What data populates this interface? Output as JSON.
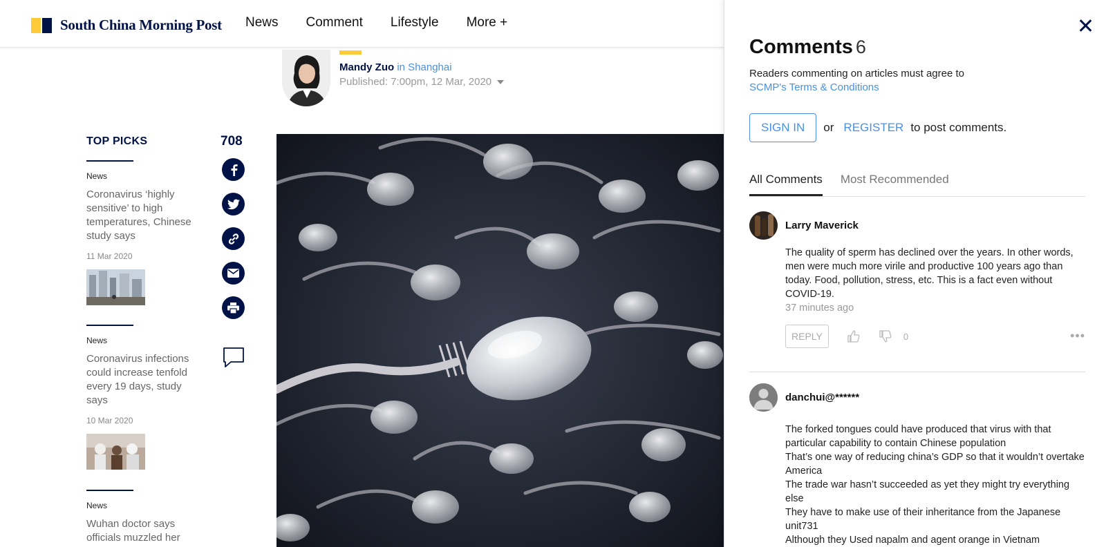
{
  "header": {
    "logo_text": "South China Morning Post",
    "nav": [
      "News",
      "Comment",
      "Lifestyle",
      "More +"
    ]
  },
  "article": {
    "author_name": "Mandy Zuo",
    "author_location": "in Shanghai",
    "published": "Published: 7:00pm, 12 Mar, 2020"
  },
  "top_picks": {
    "title": "TOP PICKS",
    "items": [
      {
        "category": "News",
        "title": "Coronavirus ‘highly sensitive’ to high temperatures, Chinese study says",
        "date": "11 Mar 2020"
      },
      {
        "category": "News",
        "title": "Coronavirus infections could increase tenfold every 19 days, study says",
        "date": "10 Mar 2020"
      },
      {
        "category": "News",
        "title": "Wuhan doctor says officials muzzled her"
      }
    ]
  },
  "share": {
    "count": "708",
    "icons": [
      "facebook-icon",
      "twitter-icon",
      "link-icon",
      "email-icon",
      "print-icon",
      "comment-icon"
    ]
  },
  "comments_panel": {
    "title": "Comments",
    "count": "6",
    "terms_text": "Readers commenting on articles must agree to",
    "terms_link": "SCMP's Terms & Conditions",
    "sign_in": "SIGN IN",
    "or": "or",
    "register": "REGISTER",
    "post_text": "to post comments.",
    "tabs": [
      "All Comments",
      "Most Recommended"
    ],
    "comments": [
      {
        "name": "Larry Maverick",
        "body": "The quality of sperm has declined over the years. In other words, men were much more virile and productive 100 years ago than today. Food, pollution, stress, etc. This is a fact even without COVID-19.",
        "time": "37 minutes ago",
        "reply": "REPLY",
        "votes": "0"
      },
      {
        "name": "danchui@******",
        "body_lines": [
          "The forked tongues could have produced that virus with that particular capability to contain Chinese population",
          "That’s one way of reducing china’s GDP so that it wouldn’t overtake America",
          "The trade war hasn’t succeeded as yet they might try everything else",
          "They have to make use of their inheritance from the Japanese unit731",
          "Although they Used napalm and agent orange in Vietnam"
        ]
      }
    ]
  },
  "colors": {
    "navy": "#001246",
    "yellow": "#ffca3a",
    "link_blue": "#4a90e2"
  }
}
